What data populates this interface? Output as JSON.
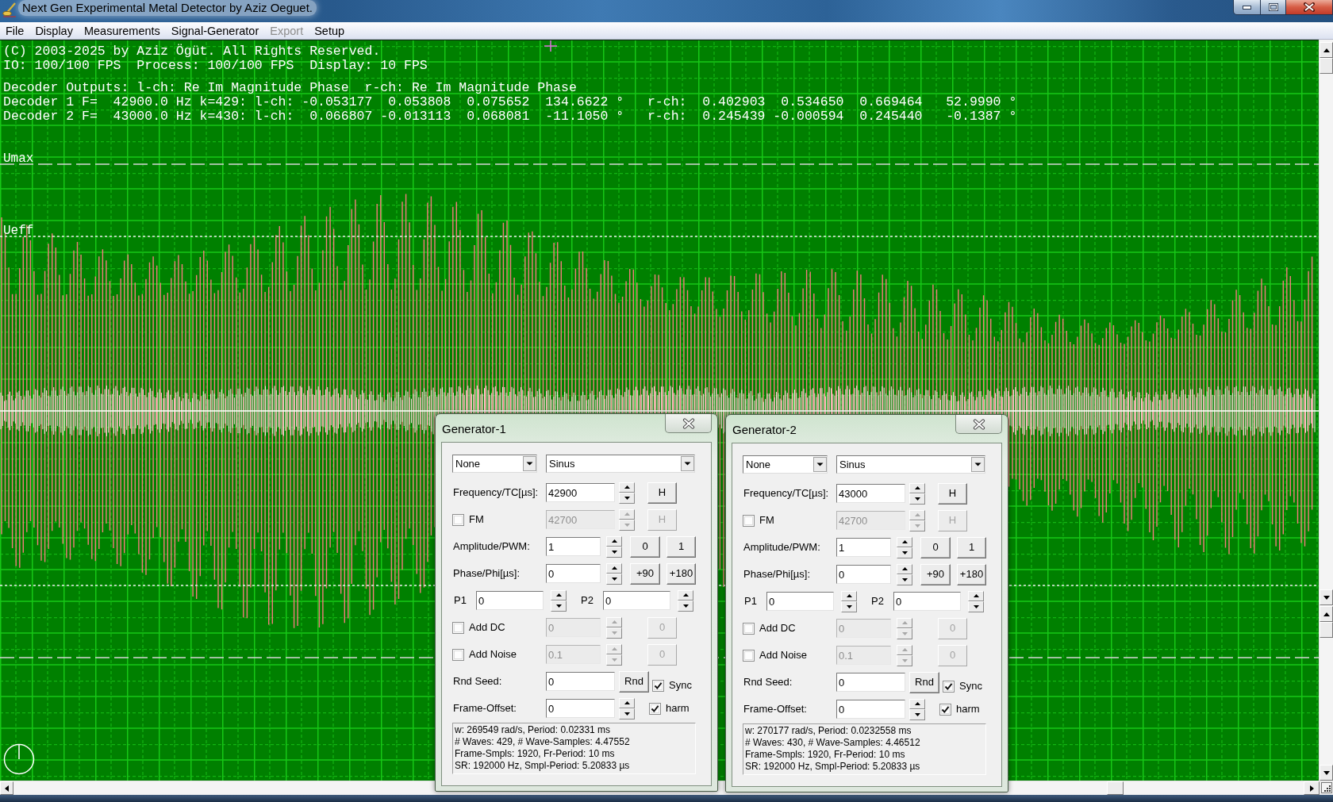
{
  "window": {
    "title": "Next Gen Experimental Metal Detector by Aziz Oeguet."
  },
  "menu": [
    {
      "label": "File",
      "disabled": false
    },
    {
      "label": "Display",
      "disabled": false
    },
    {
      "label": "Measurements",
      "disabled": false
    },
    {
      "label": "Signal-Generator",
      "disabled": false
    },
    {
      "label": "Export",
      "disabled": true
    },
    {
      "label": "Setup",
      "disabled": false
    }
  ],
  "scope": {
    "status_lines": [
      "(C) 2003-2025 by Aziz Ögüt. All Rights Reserved.",
      "IO: 100/100 FPS  Process: 100/100 FPS  Display: 10 FPS"
    ],
    "decoder_lines": [
      "Decoder Outputs: l-ch: Re Im Magnitude Phase  r-ch: Re Im Magnitude Phase",
      "Decoder 1 F=  42900.0 Hz k=429: l-ch: -0.053177  0.053808  0.075652  134.6622 °   r-ch:  0.402903  0.534650  0.669464   52.9990 °",
      "Decoder 2 F=  43000.0 Hz k=430: l-ch:  0.066807 -0.013113  0.068081  -11.1050 °   r-ch:  0.245439 -0.000594  0.245440   -0.1387 °"
    ],
    "reference_levels": [
      {
        "label": "Umax",
        "kind": "peak"
      },
      {
        "label": "Ueff",
        "kind": "rms"
      }
    ]
  },
  "generators": [
    {
      "title": "Generator-1",
      "selects": [
        "None",
        "Sinus"
      ],
      "rows": [
        {
          "kind": "wide-field",
          "label": "Frequency/TC[µs]:",
          "value": "42900",
          "disabled": false,
          "buttons": [
            "H"
          ]
        },
        {
          "kind": "wide-check",
          "label": "FM",
          "checked": false,
          "value": "42700",
          "disabled": true,
          "buttons": [
            "H"
          ]
        },
        {
          "kind": "narrow-field",
          "label": "Amplitude/PWM:",
          "value": "1",
          "disabled": false,
          "buttons": [
            "0",
            "1"
          ]
        },
        {
          "kind": "narrow-field",
          "label": "Phase/Phi[µs]:",
          "value": "0",
          "disabled": false,
          "buttons": [
            "+90",
            "+180"
          ]
        },
        {
          "kind": "pair",
          "fields": [
            {
              "label": "P1",
              "value": "0"
            },
            {
              "label": "P2",
              "value": "0"
            }
          ]
        },
        {
          "kind": "narrow-check",
          "label": "Add DC",
          "checked": false,
          "value": "0",
          "disabled": true,
          "buttons": [
            "0"
          ]
        },
        {
          "kind": "narrow-check",
          "label": "Add Noise",
          "checked": false,
          "value": "0.1",
          "disabled": true,
          "buttons": [
            "0"
          ]
        },
        {
          "kind": "seed-field",
          "label": "Rnd Seed:",
          "value": "0",
          "disabled": false,
          "buttons": [
            "Rnd"
          ],
          "option": {
            "label": "Sync",
            "checked": true
          }
        },
        {
          "kind": "wide-field",
          "label": "Frame-Offset:",
          "value": "0",
          "disabled": false,
          "option": {
            "label": "harm",
            "checked": true
          }
        }
      ],
      "info": [
        "w: 269549 rad/s, Period: 0.02331 ms",
        "# Waves: 429, # Wave-Samples: 4.47552",
        "Frame-Smpls: 1920, Fr-Period: 10 ms",
        "SR: 192000 Hz, Smpl-Period: 5.20833 µs"
      ]
    },
    {
      "title": "Generator-2",
      "selects": [
        "None",
        "Sinus"
      ],
      "rows": [
        {
          "kind": "wide-field",
          "label": "Frequency/TC[µs]:",
          "value": "43000",
          "disabled": false,
          "buttons": [
            "H"
          ]
        },
        {
          "kind": "wide-check",
          "label": "FM",
          "checked": false,
          "value": "42700",
          "disabled": true,
          "buttons": [
            "H"
          ]
        },
        {
          "kind": "narrow-field",
          "label": "Amplitude/PWM:",
          "value": "1",
          "disabled": false,
          "buttons": [
            "0",
            "1"
          ]
        },
        {
          "kind": "narrow-field",
          "label": "Phase/Phi[µs]:",
          "value": "0",
          "disabled": false,
          "buttons": [
            "+90",
            "+180"
          ]
        },
        {
          "kind": "pair",
          "fields": [
            {
              "label": "P1",
              "value": "0"
            },
            {
              "label": "P2",
              "value": "0"
            }
          ]
        },
        {
          "kind": "narrow-check",
          "label": "Add DC",
          "checked": false,
          "value": "0",
          "disabled": true,
          "buttons": [
            "0"
          ]
        },
        {
          "kind": "narrow-check",
          "label": "Add Noise",
          "checked": false,
          "value": "0.1",
          "disabled": true,
          "buttons": [
            "0"
          ]
        },
        {
          "kind": "seed-field",
          "label": "Rnd Seed:",
          "value": "0",
          "disabled": false,
          "buttons": [
            "Rnd"
          ],
          "option": {
            "label": "Sync",
            "checked": true
          }
        },
        {
          "kind": "wide-field",
          "label": "Frame-Offset:",
          "value": "0",
          "disabled": false,
          "option": {
            "label": "harm",
            "checked": true
          }
        }
      ],
      "info": [
        "w: 270177 rad/s, Period: 0.0232558 ms",
        "# Waves: 430, # Wave-Samples: 4.46512",
        "Frame-Smpls: 1920, Fr-Period: 10 ms",
        "SR: 192000 Hz, Smpl-Period: 5.20833 µs"
      ]
    }
  ]
}
